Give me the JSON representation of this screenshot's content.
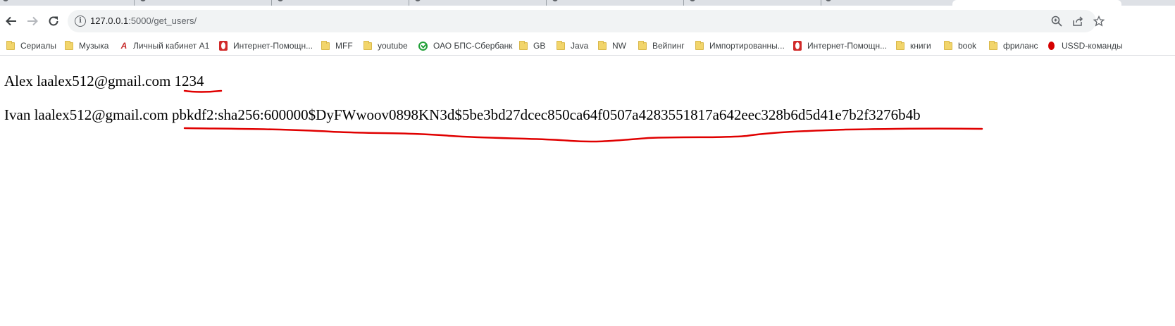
{
  "browser": {
    "url_host": "127.0.0.1",
    "url_path": ":5000/get_users/",
    "info_glyph": "i",
    "back_icon": "arrow-left-icon",
    "forward_icon": "arrow-right-icon",
    "reload_icon": "reload-icon",
    "zoom_icon": "zoom-icon",
    "share_icon": "share-icon",
    "star_icon": "star-icon"
  },
  "bookmarks": [
    {
      "label": "Сериалы",
      "icon": "folder-icon"
    },
    {
      "label": "Музыка",
      "icon": "folder-icon"
    },
    {
      "label": "Личный кабинет А1",
      "icon": "a1-logo-icon"
    },
    {
      "label": "Интернет-Помощн...",
      "icon": "opera-icon"
    },
    {
      "label": "MFF",
      "icon": "folder-icon"
    },
    {
      "label": "youtube",
      "icon": "folder-icon"
    },
    {
      "label": "ОАО БПС-Сбербанк",
      "icon": "sberbank-icon"
    },
    {
      "label": "GB",
      "icon": "folder-icon"
    },
    {
      "label": "Java",
      "icon": "folder-icon"
    },
    {
      "label": "NW",
      "icon": "folder-icon"
    },
    {
      "label": "Вейпинг",
      "icon": "folder-icon"
    },
    {
      "label": "Импортированны...",
      "icon": "folder-icon"
    },
    {
      "label": "Интернет-Помощн...",
      "icon": "opera-icon"
    },
    {
      "label": "книги",
      "icon": "folder-icon"
    },
    {
      "label": "book",
      "icon": "folder-icon"
    },
    {
      "label": "фриланс",
      "icon": "folder-icon"
    },
    {
      "label": "USSD-команды",
      "icon": "ussd-icon"
    }
  ],
  "users": [
    {
      "name": "Alex",
      "email": "laalex512@gmail.com",
      "password": "1234"
    },
    {
      "name": "Ivan",
      "email": "laalex512@gmail.com",
      "password": "pbkdf2:sha256:600000$DyFWwoov0898KN3d$5be3bd27dcec850ca64f0507a4283551817a642eec328b6d5d41e7b2f3276b4b"
    }
  ],
  "colors": {
    "annotation_red": "#e00000",
    "tab_strip": "#dee1e6",
    "omnibox_bg": "#f1f3f4"
  }
}
